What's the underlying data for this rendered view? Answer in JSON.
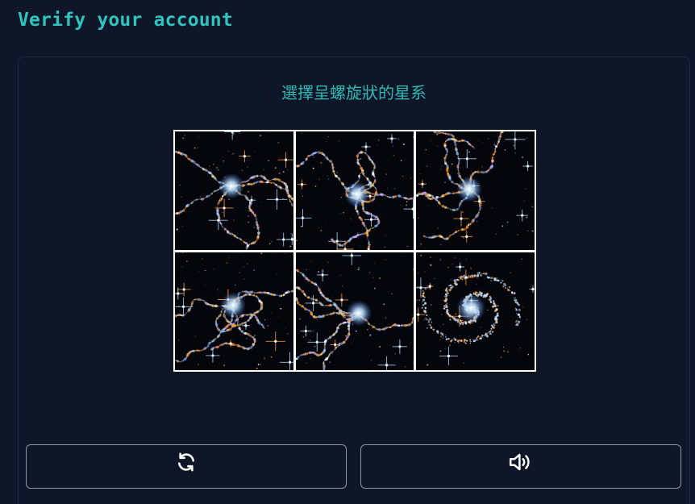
{
  "header": {
    "title": "Verify your account"
  },
  "captcha": {
    "prompt": "選擇呈螺旋狀的星系",
    "tiles": [
      {
        "icon": "galaxy-tile-icon"
      },
      {
        "icon": "galaxy-tile-icon"
      },
      {
        "icon": "galaxy-tile-icon"
      },
      {
        "icon": "galaxy-tile-icon"
      },
      {
        "icon": "galaxy-tile-icon"
      },
      {
        "icon": "spiral-galaxy-tile-icon"
      }
    ],
    "refresh_icon": "refresh-icon",
    "audio_icon": "speaker-icon"
  },
  "colors": {
    "background": "#0e1628",
    "accent": "#2ec4c0",
    "button_border": "#8d96a6"
  }
}
